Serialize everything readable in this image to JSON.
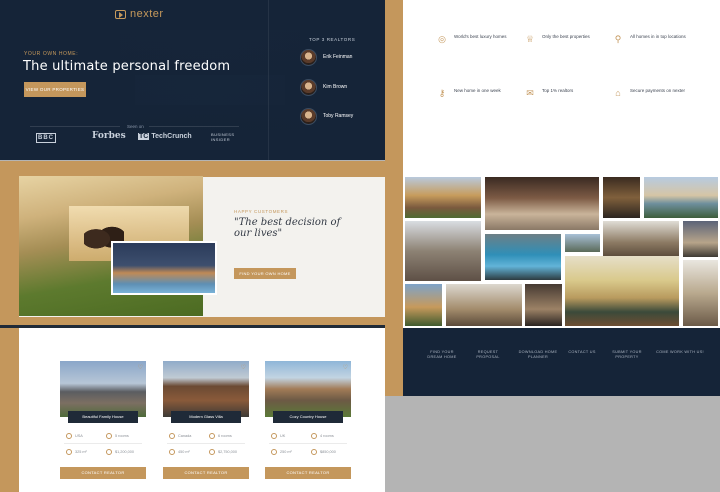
{
  "hero": {
    "logo": "nexter",
    "eyebrow": "YOUR OWN HOME:",
    "title": "The ultimate personal freedom",
    "cta": "VIEW OUR PROPERTIES",
    "seen_on": "Seen on",
    "brands": [
      "BBC",
      "Forbes",
      "TechCrunch",
      "BUSINESS INSIDER"
    ]
  },
  "realtors": {
    "title": "TOP 3 REALTORS",
    "items": [
      {
        "name": "Erik Feinman"
      },
      {
        "name": "Kim Brown"
      },
      {
        "name": "Toby Ramsey"
      }
    ]
  },
  "features": [
    {
      "icon": "globe-icon",
      "title": "World's best luxury homes"
    },
    {
      "icon": "trophy-icon",
      "title": "Only the best properties"
    },
    {
      "icon": "map-pin-icon",
      "title": "All homes in in top locations"
    },
    {
      "icon": "key-icon",
      "title": "New home in one week"
    },
    {
      "icon": "chat-icon",
      "title": "Top 1% realtors"
    },
    {
      "icon": "lock-icon",
      "title": "Secure payments on nexter"
    }
  ],
  "testimonial": {
    "eyebrow": "HAPPY CUSTOMERS",
    "quote": "\"The best decision of our lives\"",
    "cta": "FIND YOUR OWN HOME"
  },
  "listings": [
    {
      "name": "Beautiful Family House",
      "location": "USA",
      "rooms": "5 rooms",
      "area": "325 m²",
      "price": "$1,200,000",
      "cta": "CONTACT REALTOR"
    },
    {
      "name": "Modern Glass Villa",
      "location": "Canada",
      "rooms": "6 rooms",
      "area": "450 m²",
      "price": "$2,750,000",
      "cta": "CONTACT REALTOR"
    },
    {
      "name": "Cozy Country House",
      "location": "UK",
      "rooms": "4 rooms",
      "area": "250 m²",
      "price": "$850,000",
      "cta": "CONTACT REALTOR"
    }
  ],
  "footer": {
    "links": [
      "FIND YOUR DREAM HOME",
      "REQUEST PROPOSAL",
      "DOWNLOAD HOME PLANNER",
      "CONTACT US",
      "SUBMIT YOUR PROPERTY",
      "COME WORK WITH US!"
    ]
  },
  "colors": {
    "navy": "#152438",
    "gold": "#c4975c"
  }
}
